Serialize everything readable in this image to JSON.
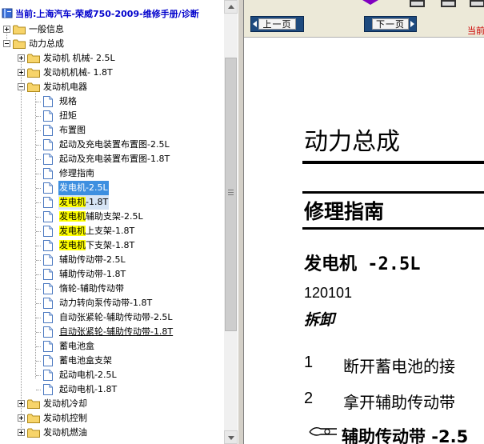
{
  "tree": {
    "header": "当前:上海汽车-荣威750-2009-维修手册/诊断",
    "items": [
      {
        "label": "一般信息",
        "level": 0,
        "type": "folder",
        "toggle": "plus"
      },
      {
        "label": "动力总成",
        "level": 0,
        "type": "folder",
        "toggle": "minus"
      },
      {
        "label": "发动机 机械- 2.5L",
        "level": 1,
        "type": "folder",
        "toggle": "plus"
      },
      {
        "label": "发动机机械- 1.8T",
        "level": 1,
        "type": "folder",
        "toggle": "plus"
      },
      {
        "label": "发动机电器",
        "level": 1,
        "type": "folder",
        "toggle": "minus"
      },
      {
        "label": "规格",
        "level": 2,
        "type": "page"
      },
      {
        "label": "扭矩",
        "level": 2,
        "type": "page"
      },
      {
        "label": "布置图",
        "level": 2,
        "type": "page"
      },
      {
        "label": "起动及充电装置布置图-2.5L",
        "level": 2,
        "type": "page"
      },
      {
        "label": "起动及充电装置布置图-1.8T",
        "level": 2,
        "type": "page"
      },
      {
        "label": "修理指南",
        "level": 2,
        "type": "page"
      },
      {
        "label": "发电机-2.5L",
        "level": 2,
        "type": "page",
        "state": "selected"
      },
      {
        "label": "发电机-1.8T",
        "level": 2,
        "type": "page",
        "state": "hover"
      },
      {
        "label": "发电机辅助支架-2.5L",
        "level": 2,
        "type": "page"
      },
      {
        "label": "发电机上支架-1.8T",
        "level": 2,
        "type": "page"
      },
      {
        "label": "发电机下支架-1.8T",
        "level": 2,
        "type": "page"
      },
      {
        "label": "辅助传动带-2.5L",
        "level": 2,
        "type": "page"
      },
      {
        "label": "辅助传动带-1.8T",
        "level": 2,
        "type": "page"
      },
      {
        "label": "惰轮-辅助传动带",
        "level": 2,
        "type": "page"
      },
      {
        "label": "动力转向泵传动带-1.8T",
        "level": 2,
        "type": "page"
      },
      {
        "label": "自动张紧轮-辅助传动带-2.5L",
        "level": 2,
        "type": "page"
      },
      {
        "label": "自动张紧轮-辅助传动带-1.8T",
        "level": 2,
        "type": "page",
        "state": "underline"
      },
      {
        "label": "蓄电池盒",
        "level": 2,
        "type": "page"
      },
      {
        "label": "蓄电池盒支架",
        "level": 2,
        "type": "page"
      },
      {
        "label": "起动电机-2.5L",
        "level": 2,
        "type": "page"
      },
      {
        "label": "起动电机-1.8T",
        "level": 2,
        "type": "page"
      },
      {
        "label": "发动机冷却",
        "level": 1,
        "type": "folder",
        "toggle": "plus"
      },
      {
        "label": "发动机控制",
        "level": 1,
        "type": "folder",
        "toggle": "plus"
      },
      {
        "label": "发动机燃油",
        "level": 1,
        "type": "folder",
        "toggle": "plus"
      }
    ],
    "highlight_term": "发电机"
  },
  "toolbar": {
    "prev_label": "上一页",
    "next_label": "下一页",
    "current_tag": "当前"
  },
  "document": {
    "title": "动力总成",
    "section": "修理指南",
    "subtitle": "发电机 -2.5L",
    "code": "120101",
    "remove_heading": "拆卸",
    "steps": [
      {
        "num": "1",
        "text": "断开蓄电池的接"
      },
      {
        "num": "2",
        "text": "拿开辅助传动带"
      }
    ],
    "figure_caption": "辅助传动带 -2.5"
  },
  "colors": {
    "link_blue": "#0000cc",
    "selection": "#3d8fe0",
    "highlight": "#ffff00",
    "nav_button": "#1e4a7e",
    "current_red": "#cc0000"
  },
  "icons": {
    "book": "book-icon",
    "folder": "folder-icon",
    "page": "page-icon",
    "prev": "arrow-left-icon",
    "next": "arrow-right-icon",
    "belt": "belt-icon"
  }
}
